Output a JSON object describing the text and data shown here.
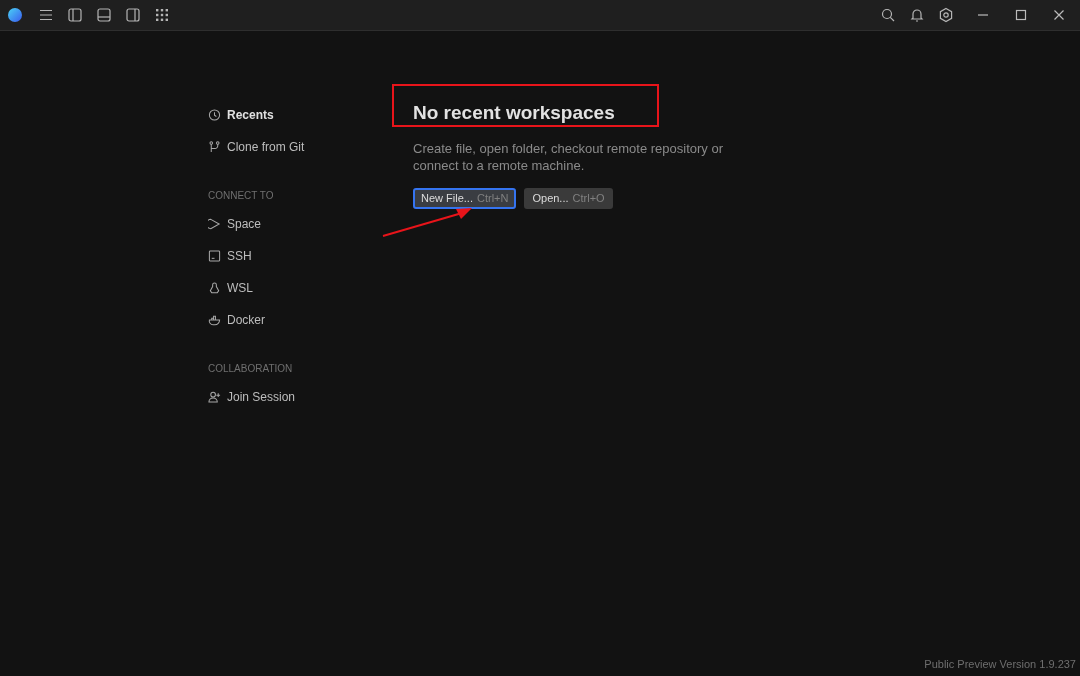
{
  "sidebar": {
    "sections": [
      {
        "items": [
          {
            "label": "Recents",
            "selected": true
          },
          {
            "label": "Clone from Git",
            "selected": false
          }
        ]
      },
      {
        "header": "CONNECT TO",
        "items": [
          {
            "label": "Space",
            "selected": false
          },
          {
            "label": "SSH",
            "selected": false
          },
          {
            "label": "WSL",
            "selected": false
          },
          {
            "label": "Docker",
            "selected": false
          }
        ]
      },
      {
        "header": "COLLABORATION",
        "items": [
          {
            "label": "Join Session",
            "selected": false
          }
        ]
      }
    ]
  },
  "main": {
    "heading": "No recent workspaces",
    "description": "Create file, open folder, checkout remote repository or connect to a remote machine.",
    "buttons": [
      {
        "label": "New File...",
        "shortcut": "Ctrl+N",
        "focused": true
      },
      {
        "label": "Open...",
        "shortcut": "Ctrl+O",
        "focused": false
      }
    ]
  },
  "status": {
    "version": "Public Preview Version 1.9.237"
  }
}
